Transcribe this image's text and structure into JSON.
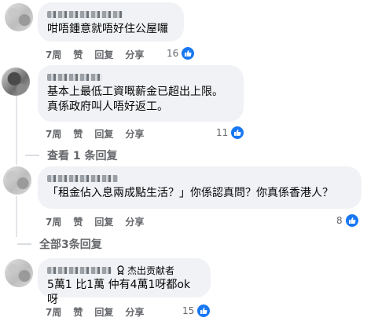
{
  "comments": [
    {
      "text": "咁唔鍾意就唔好住公屋囉",
      "time": "7周",
      "like": "赞",
      "reply": "回复",
      "share": "分享",
      "reactions": "16"
    },
    {
      "text": "基本上最低工資嘅薪金已超出上限。\n真係政府叫人唔好返工。",
      "time": "7周",
      "like": "赞",
      "reply": "回复",
      "share": "分享",
      "reactions": "11"
    },
    {
      "text": "「租金佔入息兩成點生活？」你係認真問？你真係香港人？",
      "time": "7周",
      "like": "赞",
      "reply": "回复",
      "share": "分享",
      "reactions": "8"
    },
    {
      "badge": "杰出贡献者",
      "text": "5萬1 比1萬 仲有4萬1呀都ok呀",
      "time": "7周",
      "like": "赞",
      "reply": "回复",
      "share": "分享",
      "reactions": "15"
    }
  ],
  "view_replies": "查看 1 条回复",
  "all_replies": "全部3条回复",
  "colors": {
    "like_blue": "#1877f2",
    "bubble_bg": "#f0f2f5",
    "meta_gray": "#65676b"
  },
  "icons": {
    "reaction": "thumbs-up-icon",
    "badge": "contributor-badge-icon"
  }
}
